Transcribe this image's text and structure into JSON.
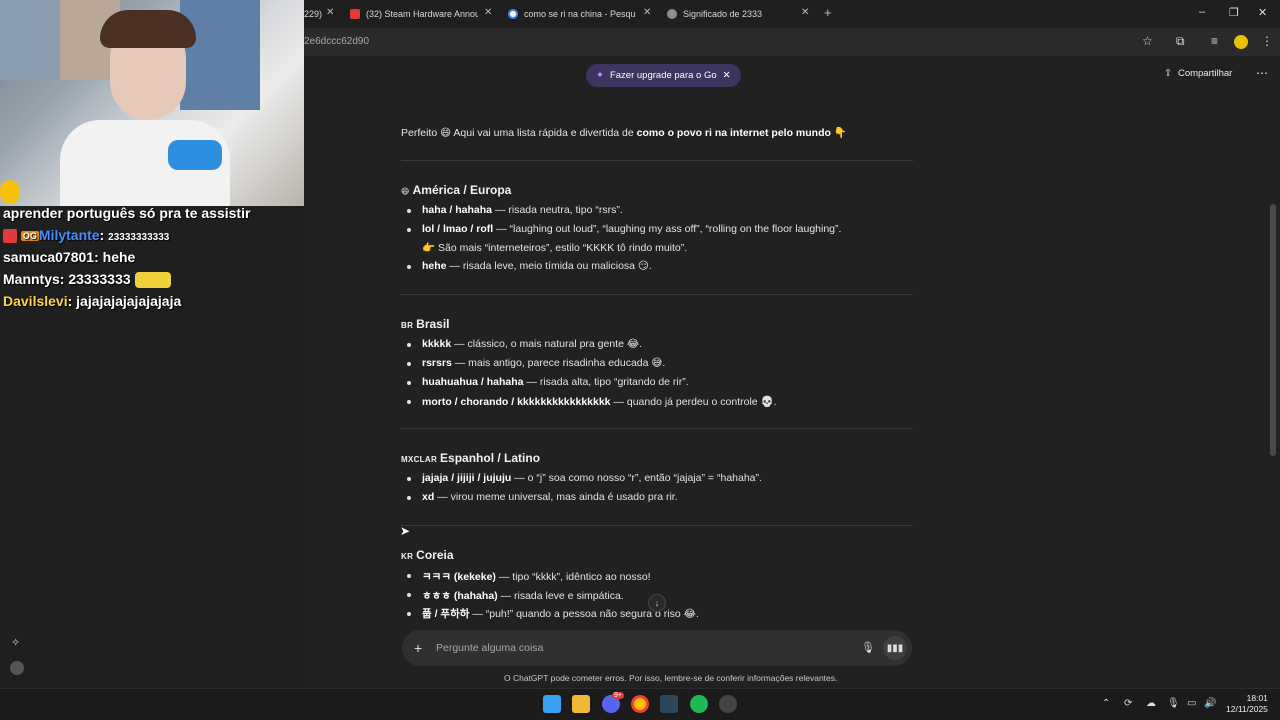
{
  "browser": {
    "tabs": [
      {
        "label": "229)"
      },
      {
        "label": "(32) Steam Hardware Announce"
      },
      {
        "label": "como se ri na china - Pesquisa"
      },
      {
        "label": "Significado de 2333"
      }
    ],
    "new_tab": "+",
    "url_fragment": "2e6dccc62d90",
    "window_controls": {
      "minimize": "–",
      "restore": "❐",
      "close": "✕"
    }
  },
  "stream": {
    "chat": [
      {
        "user": "",
        "message": "aprender português só pra te assistir",
        "user_color": ""
      },
      {
        "user": "Milytante",
        "message": "23333333333",
        "user_color": "#4a8cff",
        "badge": "OG"
      },
      {
        "user": "samuca07801",
        "message": "hehe",
        "user_color": "#ffffff"
      },
      {
        "user": "Manntys",
        "message": "23333333",
        "user_color": "#ffffff"
      },
      {
        "user": "Davilslevi",
        "message": "jajajajajajajajaja",
        "user_color": "#ffd24a"
      }
    ]
  },
  "chatgpt": {
    "upgrade_label": "Fazer upgrade para o Go",
    "share_label": "Compartilhar",
    "intro": {
      "prefix": "Perfeito 😄 Aqui vai uma lista rápida e divertida de ",
      "bold": "como o povo ri na internet pelo mundo",
      "suffix": " 👇"
    },
    "sections": [
      {
        "flag": "😄",
        "title": "América / Europa",
        "items": [
          {
            "bold": "haha / hahaha",
            "text": " — risada neutra, tipo “rsrs”."
          },
          {
            "bold": "lol / lmao / rofl",
            "text": " — “laughing out loud”, “laughing my ass off”, “rolling on the floor laughing”."
          },
          {
            "bold": "",
            "text": "👉 São mais “interneteiros”, estilo “KKKK tô rindo muito”."
          },
          {
            "bold": "hehe",
            "text": " — risada leve, meio tímida ou maliciosa 😏."
          }
        ]
      },
      {
        "flag": "BR",
        "title": "Brasil",
        "items": [
          {
            "bold": "kkkkk",
            "text": " — clássico, o mais natural pra gente 😂."
          },
          {
            "bold": "rsrsrs",
            "text": " — mais antigo, parece risadinha educada 😅."
          },
          {
            "bold": "huahuahua / hahaha",
            "text": " — risada alta, tipo “gritando de rir”."
          },
          {
            "bold": "morto / chorando / kkkkkkkkkkkkkkkk",
            "text": " — quando já perdeu o controle 💀."
          }
        ]
      },
      {
        "flag": "MXCLAR",
        "title": "Espanhol / Latino",
        "items": [
          {
            "bold": "jajaja / jijiji / jujuju",
            "text": " — o “j” soa como nosso “r”, então “jajaja” = “hahaha”."
          },
          {
            "bold": "xd",
            "text": " — virou meme universal, mas ainda é usado pra rir."
          }
        ]
      },
      {
        "flag": "KR",
        "title": "Coreia",
        "items": [
          {
            "bold": "ㅋㅋㅋ (kekeke)",
            "text": " — tipo “kkkk”, idêntico ao nosso!"
          },
          {
            "bold": "ㅎㅎㅎ (hahaha)",
            "text": " — risada leve e simpática."
          },
          {
            "bold": "풉 / 푸하하",
            "text": " — “puh!” quando a pessoa não segura o riso 😂."
          }
        ]
      }
    ],
    "input_placeholder": "Pergunte alguma coisa",
    "disclaimer": "O ChatGPT pode cometer erros. Por isso, lembre-se de conferir informações relevantes."
  },
  "taskbar": {
    "time": "18:01",
    "date": "12/11/2025",
    "discord_badge": "9+"
  }
}
